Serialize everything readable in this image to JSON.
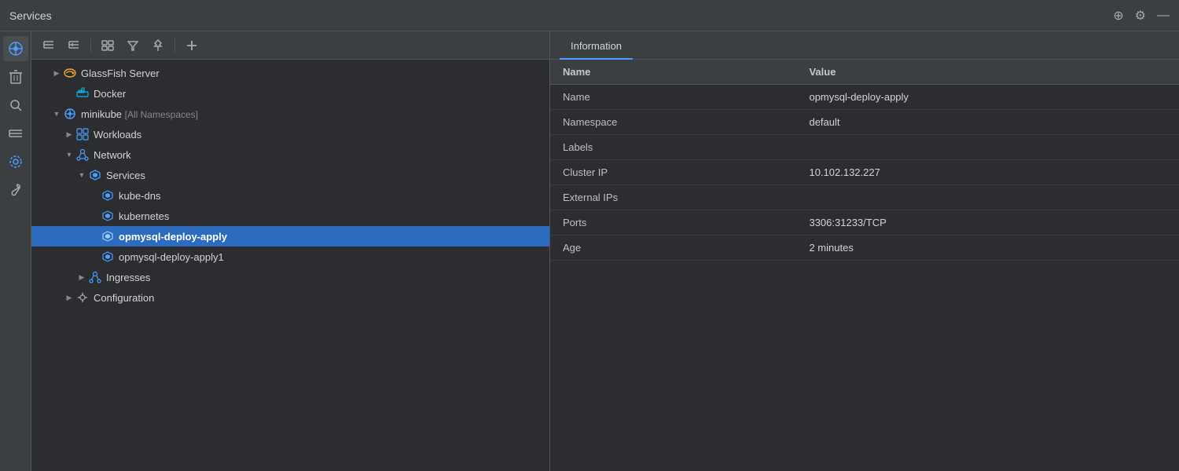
{
  "titleBar": {
    "title": "Services",
    "addIcon": "⊕",
    "settingsIcon": "⚙",
    "minimizeIcon": "—"
  },
  "toolbar": {
    "buttons": [
      {
        "name": "collapse-all",
        "icon": "≡",
        "label": "Collapse All"
      },
      {
        "name": "expand-all",
        "icon": "⋮",
        "label": "Expand All"
      },
      {
        "name": "group",
        "icon": "⊞",
        "label": "Group"
      },
      {
        "name": "filter",
        "icon": "⌥",
        "label": "Filter"
      },
      {
        "name": "pin",
        "icon": "⊟",
        "label": "Pin"
      },
      {
        "name": "add",
        "icon": "+",
        "label": "Add"
      }
    ]
  },
  "sidebarIcons": [
    {
      "name": "services-icon",
      "icon": "◈",
      "active": true
    },
    {
      "name": "delete-icon",
      "icon": "🗑"
    },
    {
      "name": "search-icon",
      "icon": "○"
    },
    {
      "name": "layers-icon",
      "icon": "☰"
    },
    {
      "name": "settings-icon",
      "icon": "⚙"
    },
    {
      "name": "wrench-icon",
      "icon": "🔧"
    }
  ],
  "tree": {
    "items": [
      {
        "id": "glassfish",
        "indent": 1,
        "expand": "▶",
        "icon": "🐟",
        "iconColor": "#f0a030",
        "label": "GlassFish Server",
        "labelExtra": "",
        "selected": false
      },
      {
        "id": "docker",
        "indent": 2,
        "expand": "",
        "icon": "🐳",
        "iconColor": "#0db7ed",
        "label": "Docker",
        "labelExtra": "",
        "selected": false
      },
      {
        "id": "minikube",
        "indent": 1,
        "expand": "▼",
        "icon": "⎈",
        "iconColor": "#4a9eff",
        "label": "minikube",
        "labelExtra": " [All Namespaces]",
        "selected": false
      },
      {
        "id": "workloads",
        "indent": 2,
        "expand": "▶",
        "icon": "⊞",
        "iconColor": "#4a9eff",
        "label": "Workloads",
        "labelExtra": "",
        "selected": false
      },
      {
        "id": "network",
        "indent": 2,
        "expand": "▼",
        "icon": "🔗",
        "iconColor": "#4a9eff",
        "label": "Network",
        "labelExtra": "",
        "selected": false
      },
      {
        "id": "services-node",
        "indent": 3,
        "expand": "▼",
        "icon": "⬡",
        "iconColor": "#4a9eff",
        "label": "Services",
        "labelExtra": "",
        "selected": false
      },
      {
        "id": "kube-dns",
        "indent": 4,
        "expand": "",
        "icon": "⬡",
        "iconColor": "#4a9eff",
        "label": "kube-dns",
        "labelExtra": "",
        "selected": false
      },
      {
        "id": "kubernetes",
        "indent": 4,
        "expand": "",
        "icon": "⬡",
        "iconColor": "#4a9eff",
        "label": "kubernetes",
        "labelExtra": "",
        "selected": false
      },
      {
        "id": "opmysql-deploy-apply",
        "indent": 4,
        "expand": "",
        "icon": "⬡",
        "iconColor": "#4a9eff",
        "label": "opmysql-deploy-apply",
        "labelExtra": "",
        "selected": true
      },
      {
        "id": "opmysql-deploy-apply1",
        "indent": 4,
        "expand": "",
        "icon": "⬡",
        "iconColor": "#4a9eff",
        "label": "opmysql-deploy-apply1",
        "labelExtra": "",
        "selected": false
      },
      {
        "id": "ingresses",
        "indent": 3,
        "expand": "▶",
        "icon": "🔗",
        "iconColor": "#4a9eff",
        "label": "Ingresses",
        "labelExtra": "",
        "selected": false
      },
      {
        "id": "configuration",
        "indent": 2,
        "expand": "▶",
        "icon": "⚙",
        "iconColor": "#aaa",
        "label": "Configuration",
        "labelExtra": "",
        "selected": false
      }
    ]
  },
  "infoPanel": {
    "tabs": [
      {
        "id": "information",
        "label": "Information",
        "active": true
      }
    ],
    "tableHeaders": {
      "name": "Name",
      "value": "Value"
    },
    "rows": [
      {
        "name": "Name",
        "value": "opmysql-deploy-apply"
      },
      {
        "name": "Namespace",
        "value": "default"
      },
      {
        "name": "Labels",
        "value": ""
      },
      {
        "name": "Cluster IP",
        "value": "10.102.132.227"
      },
      {
        "name": "External IPs",
        "value": ""
      },
      {
        "name": "Ports",
        "value": "3306:31233/TCP"
      },
      {
        "name": "Age",
        "value": "2 minutes"
      }
    ]
  }
}
